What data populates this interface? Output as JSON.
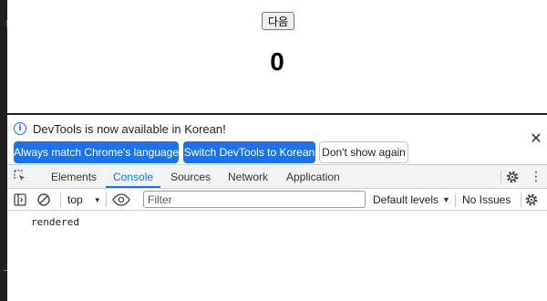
{
  "page": {
    "next_button": "다음",
    "counter": "0"
  },
  "devtools": {
    "infobar": {
      "message": "DevTools is now available in Korean!",
      "match_button": "Always match Chrome's language",
      "switch_button": "Switch DevTools to Korean",
      "dont_show_button": "Don't show again",
      "close_icon": "close-icon",
      "info_icon": "info-icon",
      "info_glyph": "i"
    },
    "tabs": [
      {
        "label": "Elements",
        "active": false
      },
      {
        "label": "Console",
        "active": true
      },
      {
        "label": "Sources",
        "active": false
      },
      {
        "label": "Network",
        "active": false
      },
      {
        "label": "Application",
        "active": false
      }
    ],
    "toolbar": {
      "context": "top",
      "filter_placeholder": "Filter",
      "levels": "Default levels",
      "issues": "No Issues"
    },
    "console": {
      "lines": [
        "rendered"
      ]
    },
    "accent": "#1a73e8"
  }
}
